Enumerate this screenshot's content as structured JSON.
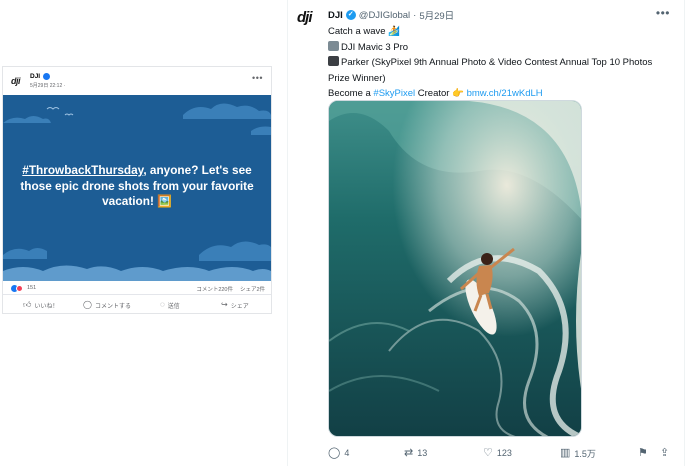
{
  "facebook_post": {
    "page_name": "DJI",
    "date": "5月29日 22:12 · ",
    "logo_text": "dji",
    "more_icon": "more-dots-icon",
    "image_text": {
      "hashtag": "#ThrowbackThursday",
      "rest": ", anyone? Let's see those epic drone shots from your favorite vacation! 🖼️"
    },
    "reaction_count": "151",
    "comments_count": "コメント220件",
    "shares_count": "シェア2件",
    "actions": {
      "like": "いいね！",
      "comment": "コメントする",
      "send": "送信",
      "share": "シェア"
    },
    "colors": {
      "sky": "#1d5d95",
      "cloud": "#3a7fb8",
      "like": "#1877f2",
      "love": "#f33e58"
    }
  },
  "x_post": {
    "avatar_text": "dji",
    "display_name": "DJI",
    "handle": "@DJIGlobal",
    "dot": "·",
    "date": "5月29日",
    "more_icon": "more-dots-icon",
    "lines": {
      "l1": "Catch a wave 🏄",
      "l2": "DJI Mavic 3 Pro",
      "l3": "Parker (SkyPixel 9th Annual Photo & Video Contest Annual Top 10 Photos Prize Winner)",
      "l4_prefix": "Become a ",
      "l4_hashtag": "#SkyPixel",
      "l4_mid": " Creator 👉 ",
      "l4_link": "bmw.ch/21wKdLH"
    },
    "actions": {
      "replies": "4",
      "reposts": "13",
      "likes": "123",
      "views": "1.5万"
    },
    "colors": {
      "accent": "#1d9bf0",
      "wave": "#1e5e58",
      "foam": "#e9efe9"
    }
  }
}
